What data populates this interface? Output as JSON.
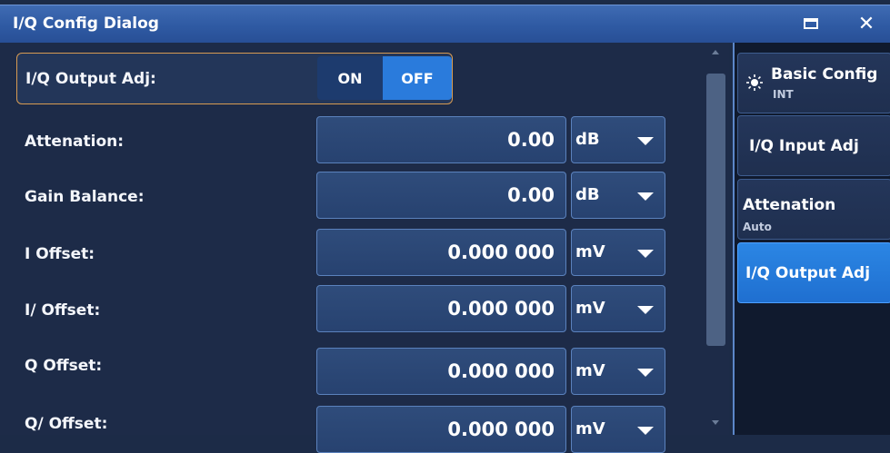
{
  "window": {
    "title": "I/Q Config Dialog",
    "maximize_icon": "maximize-icon",
    "close_glyph": "✕"
  },
  "main": {
    "output_adj": {
      "label": "I/Q Output Adj:",
      "on_label": "ON",
      "off_label": "OFF",
      "selected": "OFF"
    },
    "rows": [
      {
        "label": "Attenation:",
        "value": "0.00",
        "unit": "dB"
      },
      {
        "label": "Gain Balance:",
        "value": "0.00",
        "unit": "dB"
      },
      {
        "label": "I Offset:",
        "value": "0.000 000",
        "unit": "mV"
      },
      {
        "label": "I/ Offset:",
        "value": "0.000 000",
        "unit": "mV"
      },
      {
        "label": "Q Offset:",
        "value": "0.000 000",
        "unit": "mV"
      },
      {
        "label": "Q/ Offset:",
        "value": "0.000 000",
        "unit": "mV"
      }
    ]
  },
  "side": {
    "items": [
      {
        "label": "Basic Config",
        "sub": "INT",
        "icon": "sun-icon"
      },
      {
        "label": "I/Q Input Adj",
        "sub": ""
      },
      {
        "label": "Attenation",
        "sub": "Auto"
      },
      {
        "label": "I/Q Output Adj",
        "sub": "",
        "active": true
      }
    ]
  },
  "colors": {
    "accent": "#2a7bdc",
    "highlight_border": "#d79b52",
    "background": "#1d2b48"
  }
}
